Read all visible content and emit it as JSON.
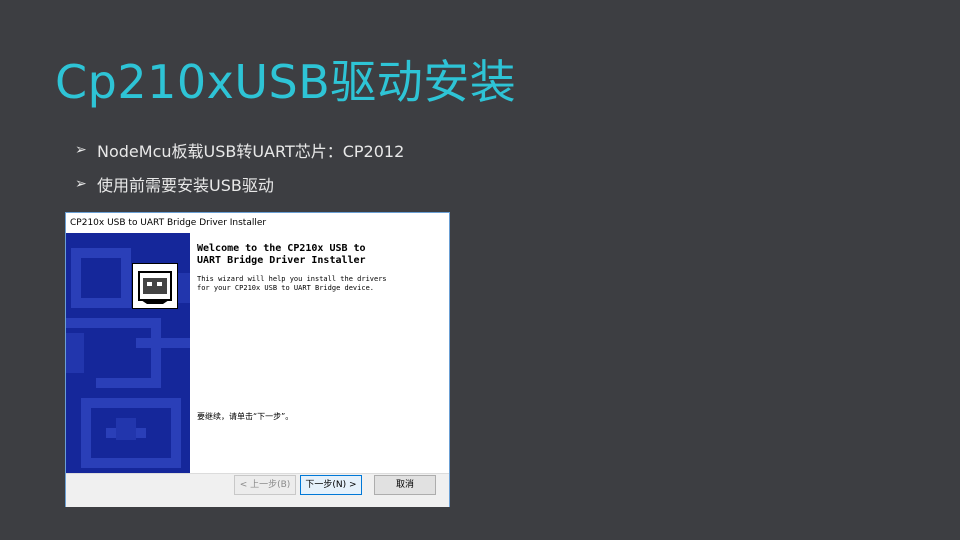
{
  "slide": {
    "title": "Cp210xUSB驱动安装",
    "bullets": [
      {
        "marker": "➢",
        "text": "NodeMcu板载USB转UART芯片：CP2012"
      },
      {
        "marker": "➢",
        "text": "使用前需要安装USB驱动"
      }
    ]
  },
  "installer": {
    "window_title": "CP210x USB to UART Bridge Driver Installer",
    "welcome_line1": "Welcome to the CP210x USB to",
    "welcome_line2": "UART Bridge Driver Installer",
    "desc_line1": "This wizard will help you install the drivers",
    "desc_line2": "for your CP210x USB to UART Bridge device.",
    "continue_text": "要继续，请单击“下一步”。",
    "buttons": {
      "back": "< 上一步(B)",
      "next": "下一步(N) >",
      "cancel": "取消"
    },
    "sidebar_color": "#15279a",
    "border_color": "#6a9fd4"
  },
  "icons": {
    "bullet": "arrowhead-bullet",
    "usb": "usb-connector-icon"
  }
}
